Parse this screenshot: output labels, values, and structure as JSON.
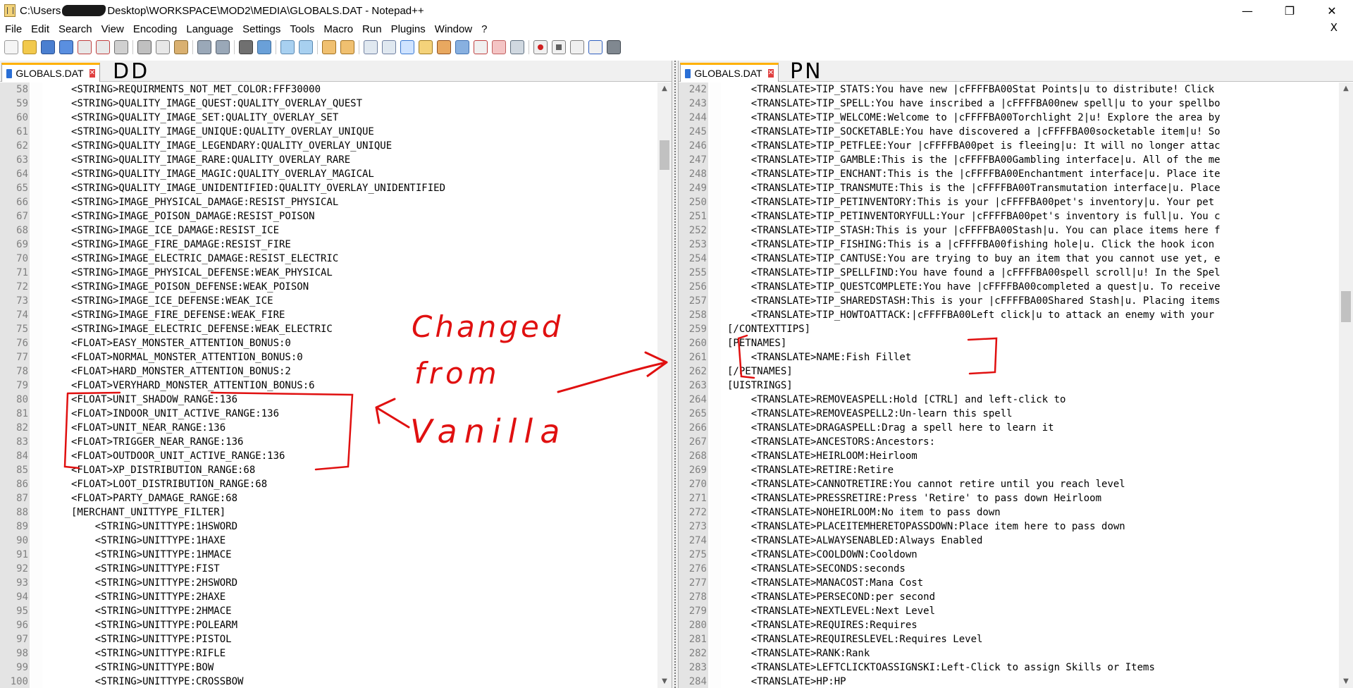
{
  "window": {
    "title_prefix": "C:\\Users",
    "title_suffix": "Desktop\\WORKSPACE\\MOD2\\MEDIA\\GLOBALS.DAT - Notepad++",
    "minimize": "—",
    "maximize": "❐",
    "close": "✕"
  },
  "menu": {
    "items": [
      "File",
      "Edit",
      "Search",
      "View",
      "Encoding",
      "Language",
      "Settings",
      "Tools",
      "Macro",
      "Run",
      "Plugins",
      "Window",
      "?"
    ],
    "close_doc": "X"
  },
  "left": {
    "tab_label": "GLOBALS.DAT",
    "handwritten_label": "DD",
    "lines": [
      {
        "n": "58",
        "t": "<STRING>REQUIRMENTS_NOT_MET_COLOR:FFF30000"
      },
      {
        "n": "59",
        "t": "<STRING>QUALITY_IMAGE_QUEST:QUALITY_OVERLAY_QUEST"
      },
      {
        "n": "60",
        "t": "<STRING>QUALITY_IMAGE_SET:QUALITY_OVERLAY_SET"
      },
      {
        "n": "61",
        "t": "<STRING>QUALITY_IMAGE_UNIQUE:QUALITY_OVERLAY_UNIQUE"
      },
      {
        "n": "62",
        "t": "<STRING>QUALITY_IMAGE_LEGENDARY:QUALITY_OVERLAY_UNIQUE"
      },
      {
        "n": "63",
        "t": "<STRING>QUALITY_IMAGE_RARE:QUALITY_OVERLAY_RARE"
      },
      {
        "n": "64",
        "t": "<STRING>QUALITY_IMAGE_MAGIC:QUALITY_OVERLAY_MAGICAL"
      },
      {
        "n": "65",
        "t": "<STRING>QUALITY_IMAGE_UNIDENTIFIED:QUALITY_OVERLAY_UNIDENTIFIED"
      },
      {
        "n": "66",
        "t": "<STRING>IMAGE_PHYSICAL_DAMAGE:RESIST_PHYSICAL"
      },
      {
        "n": "67",
        "t": "<STRING>IMAGE_POISON_DAMAGE:RESIST_POISON"
      },
      {
        "n": "68",
        "t": "<STRING>IMAGE_ICE_DAMAGE:RESIST_ICE"
      },
      {
        "n": "69",
        "t": "<STRING>IMAGE_FIRE_DAMAGE:RESIST_FIRE"
      },
      {
        "n": "70",
        "t": "<STRING>IMAGE_ELECTRIC_DAMAGE:RESIST_ELECTRIC"
      },
      {
        "n": "71",
        "t": "<STRING>IMAGE_PHYSICAL_DEFENSE:WEAK_PHYSICAL"
      },
      {
        "n": "72",
        "t": "<STRING>IMAGE_POISON_DEFENSE:WEAK_POISON"
      },
      {
        "n": "73",
        "t": "<STRING>IMAGE_ICE_DEFENSE:WEAK_ICE"
      },
      {
        "n": "74",
        "t": "<STRING>IMAGE_FIRE_DEFENSE:WEAK_FIRE"
      },
      {
        "n": "75",
        "t": "<STRING>IMAGE_ELECTRIC_DEFENSE:WEAK_ELECTRIC"
      },
      {
        "n": "76",
        "t": "<FLOAT>EASY_MONSTER_ATTENTION_BONUS:0"
      },
      {
        "n": "77",
        "t": "<FLOAT>NORMAL_MONSTER_ATTENTION_BONUS:0"
      },
      {
        "n": "78",
        "t": "<FLOAT>HARD_MONSTER_ATTENTION_BONUS:2"
      },
      {
        "n": "79",
        "t": "<FLOAT>VERYHARD_MONSTER_ATTENTION_BONUS:6"
      },
      {
        "n": "80",
        "t": "<FLOAT>UNIT_SHADOW_RANGE:136"
      },
      {
        "n": "81",
        "t": "<FLOAT>INDOOR_UNIT_ACTIVE_RANGE:136"
      },
      {
        "n": "82",
        "t": "<FLOAT>UNIT_NEAR_RANGE:136"
      },
      {
        "n": "83",
        "t": "<FLOAT>TRIGGER_NEAR_RANGE:136"
      },
      {
        "n": "84",
        "t": "<FLOAT>OUTDOOR_UNIT_ACTIVE_RANGE:136"
      },
      {
        "n": "85",
        "t": "<FLOAT>XP_DISTRIBUTION_RANGE:68"
      },
      {
        "n": "86",
        "t": "<FLOAT>LOOT_DISTRIBUTION_RANGE:68"
      },
      {
        "n": "87",
        "t": "<FLOAT>PARTY_DAMAGE_RANGE:68"
      },
      {
        "n": "88",
        "t": "[MERCHANT_UNITTYPE_FILTER]"
      },
      {
        "n": "89",
        "t": "    <STRING>UNITTYPE:1HSWORD"
      },
      {
        "n": "90",
        "t": "    <STRING>UNITTYPE:1HAXE"
      },
      {
        "n": "91",
        "t": "    <STRING>UNITTYPE:1HMACE"
      },
      {
        "n": "92",
        "t": "    <STRING>UNITTYPE:FIST"
      },
      {
        "n": "93",
        "t": "    <STRING>UNITTYPE:2HSWORD"
      },
      {
        "n": "94",
        "t": "    <STRING>UNITTYPE:2HAXE"
      },
      {
        "n": "95",
        "t": "    <STRING>UNITTYPE:2HMACE"
      },
      {
        "n": "96",
        "t": "    <STRING>UNITTYPE:POLEARM"
      },
      {
        "n": "97",
        "t": "    <STRING>UNITTYPE:PISTOL"
      },
      {
        "n": "98",
        "t": "    <STRING>UNITTYPE:RIFLE"
      },
      {
        "n": "99",
        "t": "    <STRING>UNITTYPE:BOW"
      },
      {
        "n": "100",
        "t": "    <STRING>UNITTYPE:CROSSBOW"
      }
    ]
  },
  "right": {
    "tab_label": "GLOBALS.DAT",
    "handwritten_label": "PN",
    "lines": [
      {
        "n": "242",
        "t": "    <TRANSLATE>TIP_STATS:You have new |cFFFFBA00Stat Points|u to distribute! Click"
      },
      {
        "n": "243",
        "t": "    <TRANSLATE>TIP_SPELL:You have inscribed a |cFFFFBA00new spell|u to your spellbo"
      },
      {
        "n": "244",
        "t": "    <TRANSLATE>TIP_WELCOME:Welcome to |cFFFFBA00Torchlight 2|u! Explore the area by"
      },
      {
        "n": "245",
        "t": "    <TRANSLATE>TIP_SOCKETABLE:You have discovered a |cFFFFBA00socketable item|u! So"
      },
      {
        "n": "246",
        "t": "    <TRANSLATE>TIP_PETFLEE:Your |cFFFFBA00pet is fleeing|u: It will no longer attac"
      },
      {
        "n": "247",
        "t": "    <TRANSLATE>TIP_GAMBLE:This is the |cFFFFBA00Gambling interface|u. All of the me"
      },
      {
        "n": "248",
        "t": "    <TRANSLATE>TIP_ENCHANT:This is the |cFFFFBA00Enchantment interface|u. Place ite"
      },
      {
        "n": "249",
        "t": "    <TRANSLATE>TIP_TRANSMUTE:This is the |cFFFFBA00Transmutation interface|u. Place"
      },
      {
        "n": "250",
        "t": "    <TRANSLATE>TIP_PETINVENTORY:This is your |cFFFFBA00pet's inventory|u. Your pet"
      },
      {
        "n": "251",
        "t": "    <TRANSLATE>TIP_PETINVENTORYFULL:Your |cFFFFBA00pet's inventory is full|u. You c"
      },
      {
        "n": "252",
        "t": "    <TRANSLATE>TIP_STASH:This is your |cFFFFBA00Stash|u. You can place items here f"
      },
      {
        "n": "253",
        "t": "    <TRANSLATE>TIP_FISHING:This is a |cFFFFBA00fishing hole|u. Click the hook icon"
      },
      {
        "n": "254",
        "t": "    <TRANSLATE>TIP_CANTUSE:You are trying to buy an item that you cannot use yet, e"
      },
      {
        "n": "255",
        "t": "    <TRANSLATE>TIP_SPELLFIND:You have found a |cFFFFBA00spell scroll|u! In the Spel"
      },
      {
        "n": "256",
        "t": "    <TRANSLATE>TIP_QUESTCOMPLETE:You have |cFFFFBA00completed a quest|u. To receive"
      },
      {
        "n": "257",
        "t": "    <TRANSLATE>TIP_SHAREDSTASH:This is your |cFFFFBA00Shared Stash|u. Placing items"
      },
      {
        "n": "258",
        "t": "    <TRANSLATE>TIP_HOWTOATTACK:|cFFFFBA00Left click|u to attack an enemy with your"
      },
      {
        "n": "259",
        "t": "[/CONTEXTTIPS]"
      },
      {
        "n": "260",
        "t": "[PETNAMES]"
      },
      {
        "n": "261",
        "t": "    <TRANSLATE>NAME:Fish Fillet"
      },
      {
        "n": "262",
        "t": "[/PETNAMES]"
      },
      {
        "n": "263",
        "t": "[UISTRINGS]"
      },
      {
        "n": "264",
        "t": "    <TRANSLATE>REMOVEASPELL:Hold [CTRL] and left-click to"
      },
      {
        "n": "265",
        "t": "    <TRANSLATE>REMOVEASPELL2:Un-learn this spell"
      },
      {
        "n": "266",
        "t": "    <TRANSLATE>DRAGASPELL:Drag a spell here to learn it"
      },
      {
        "n": "267",
        "t": "    <TRANSLATE>ANCESTORS:Ancestors:"
      },
      {
        "n": "268",
        "t": "    <TRANSLATE>HEIRLOOM:Heirloom"
      },
      {
        "n": "269",
        "t": "    <TRANSLATE>RETIRE:Retire"
      },
      {
        "n": "270",
        "t": "    <TRANSLATE>CANNOTRETIRE:You cannot retire until you reach level"
      },
      {
        "n": "271",
        "t": "    <TRANSLATE>PRESSRETIRE:Press 'Retire' to pass down Heirloom"
      },
      {
        "n": "272",
        "t": "    <TRANSLATE>NOHEIRLOOM:No item to pass down"
      },
      {
        "n": "273",
        "t": "    <TRANSLATE>PLACEITEMHERETOPASSDOWN:Place item here to pass down"
      },
      {
        "n": "274",
        "t": "    <TRANSLATE>ALWAYSENABLED:Always Enabled"
      },
      {
        "n": "275",
        "t": "    <TRANSLATE>COOLDOWN:Cooldown"
      },
      {
        "n": "276",
        "t": "    <TRANSLATE>SECONDS:seconds"
      },
      {
        "n": "277",
        "t": "    <TRANSLATE>MANACOST:Mana Cost"
      },
      {
        "n": "278",
        "t": "    <TRANSLATE>PERSECOND:per second"
      },
      {
        "n": "279",
        "t": "    <TRANSLATE>NEXTLEVEL:Next Level"
      },
      {
        "n": "280",
        "t": "    <TRANSLATE>REQUIRES:Requires"
      },
      {
        "n": "281",
        "t": "    <TRANSLATE>REQUIRESLEVEL:Requires Level"
      },
      {
        "n": "282",
        "t": "    <TRANSLATE>RANK:Rank"
      },
      {
        "n": "283",
        "t": "    <TRANSLATE>LEFTCLICKTOASSIGNSKI:Left-Click to assign Skills or Items"
      },
      {
        "n": "284",
        "t": "    <TRANSLATE>HP:HP"
      }
    ]
  },
  "annotation": {
    "line1": "Changed",
    "line2": "from",
    "line3": "Vanilla",
    "color": "#e01010"
  },
  "colors": {
    "tab_accent": "#ffb000",
    "gutter_bg": "#e4e4e4"
  }
}
